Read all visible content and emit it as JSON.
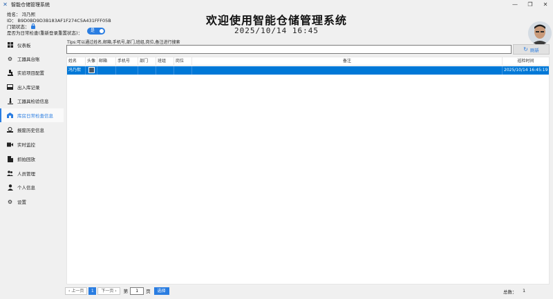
{
  "window": {
    "title": "智能仓储管理系统",
    "minimize": "—",
    "restore": "❐",
    "close": "✕"
  },
  "header": {
    "name_line": "姓名：   冯乃熙",
    "id_line": "ID：    B9D0BD9D3B183AF1F274C5A431FFF05B",
    "lock_line": "门锁状态：",
    "daily_check_line": "是否为日常检查(重新登录重置状态)：",
    "toggle_label": "是",
    "title": "欢迎使用智能仓储管理系统",
    "datetime": "2025/10/14 16:45"
  },
  "sidebar": {
    "items": [
      {
        "label": "仪表板",
        "icon": "dashboard-icon"
      },
      {
        "label": "工器具台账",
        "icon": "tools-icon"
      },
      {
        "label": "实验项目配置",
        "icon": "experiment-icon"
      },
      {
        "label": "出入库记录",
        "icon": "inbox-icon"
      },
      {
        "label": "工器具检验信息",
        "icon": "microscope-icon"
      },
      {
        "label": "库房日常检查信息",
        "icon": "warehouse-icon"
      },
      {
        "label": "报废历史信息",
        "icon": "scrap-icon"
      },
      {
        "label": "实时监控",
        "icon": "camera-icon"
      },
      {
        "label": "抓拍回放",
        "icon": "snapshot-icon"
      },
      {
        "label": "人员管理",
        "icon": "users-icon"
      },
      {
        "label": "个人信息",
        "icon": "user-icon"
      },
      {
        "label": "设置",
        "icon": "gear-icon"
      }
    ],
    "active_index": 5
  },
  "search": {
    "tips": "Tips:可以通过姓名,邮箱,手机号,部门,班组,岗位,备注进行搜索",
    "value": "",
    "refresh_label": "刷新"
  },
  "table": {
    "columns": [
      "姓名",
      "头像",
      "邮箱",
      "手机号",
      "部门",
      "班组",
      "岗位",
      "备注",
      "巡检时间"
    ],
    "rows": [
      {
        "name": "冯乃熙",
        "email": "",
        "phone": "",
        "dept": "",
        "team": "",
        "post": "",
        "remark": "",
        "time": "2025/10/14 16:45:19"
      }
    ]
  },
  "pager": {
    "prev": "上一页",
    "page": "1",
    "next": "下一页",
    "goto_prefix": "第",
    "goto_value": "1",
    "goto_suffix": "页",
    "select": "选择",
    "total_label": "总数：",
    "total_value": "1"
  },
  "colors": {
    "accent": "#2a7de1",
    "selected_row": "#0078d7"
  }
}
